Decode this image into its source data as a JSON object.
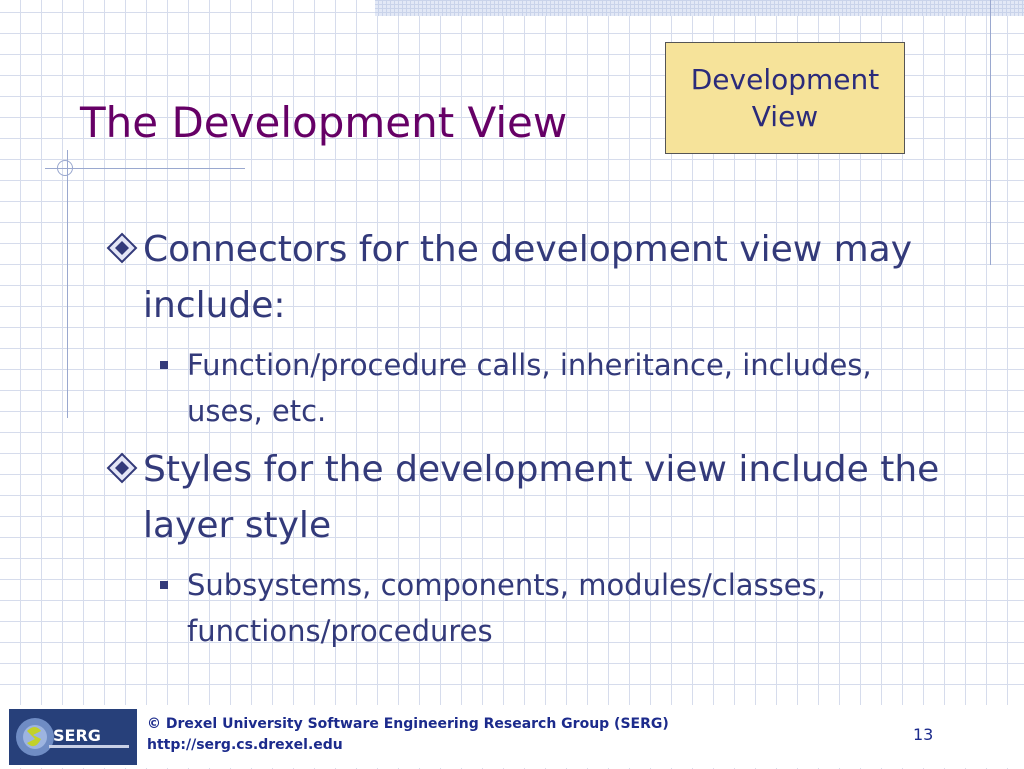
{
  "slide": {
    "title": "The Development View",
    "badge": "Development View"
  },
  "bullets": [
    {
      "text": "Connectors for the development view may include:",
      "sub": [
        "Function/procedure calls, inheritance, includes, uses, etc."
      ]
    },
    {
      "text": "Styles for the development view include the layer style",
      "sub": [
        "Subsystems, components, modules/classes, functions/procedures"
      ]
    }
  ],
  "footer": {
    "logo_text": "SERG",
    "copyright": "© Drexel University Software Engineering Research Group (SERG)",
    "url": "http://serg.cs.drexel.edu",
    "page_number": "13"
  },
  "colors": {
    "title": "#660066",
    "body_text": "#333a7a",
    "badge_fill": "#f6e39a",
    "footer_text": "#1c2b8c",
    "logo_bg": "#27407a"
  },
  "icons": {
    "level1_bullet": "diamond-bullet-icon",
    "level2_bullet": "square-bullet-icon"
  }
}
